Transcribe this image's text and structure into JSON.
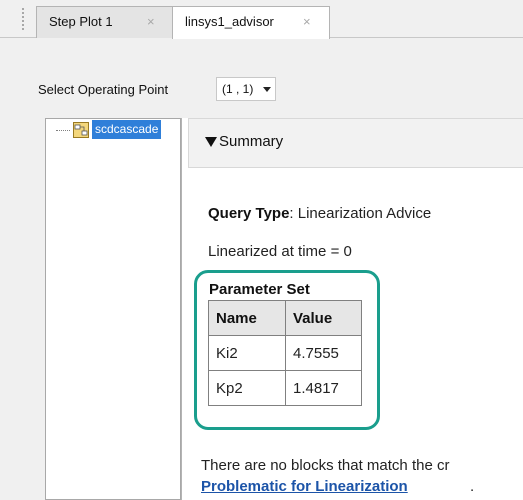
{
  "tabs": [
    {
      "label": "Step Plot 1",
      "close": "×",
      "active": false
    },
    {
      "label": "linsys1_advisor",
      "close": "×",
      "active": true
    }
  ],
  "operating_point": {
    "label": "Select Operating Point",
    "selected": "(1 , 1)"
  },
  "tree": {
    "root_label": "scdcascade",
    "icon": "simulink-model-icon"
  },
  "summary": {
    "title": "Summary",
    "query_type_label": "Query Type",
    "query_type_value": ": Linearization Advice",
    "linearized_at": "Linearized at time = 0",
    "parameter_set_title": "Parameter Set",
    "table": {
      "headers": [
        "Name",
        "Value"
      ],
      "rows": [
        [
          "Ki2",
          "4.7555"
        ],
        [
          "Kp2",
          "1.4817"
        ]
      ]
    },
    "no_blocks_text": "There are no blocks that match the cr",
    "link_text": "Problematic for Linearization",
    "link_suffix": "."
  },
  "colors": {
    "highlight": "#1a9e8d",
    "selection": "#2f7fd9",
    "link": "#1c54a8"
  }
}
